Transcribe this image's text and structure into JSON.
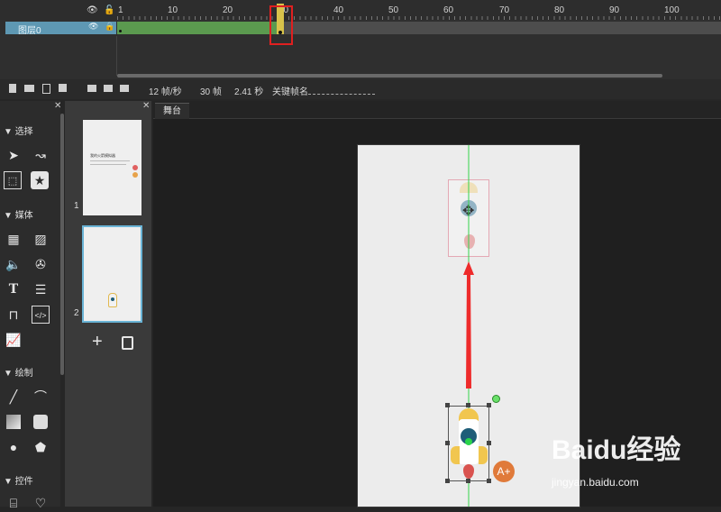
{
  "timeline": {
    "ruler_labels": [
      "1",
      "10",
      "20",
      "30",
      "40",
      "50",
      "60",
      "70",
      "80",
      "90",
      "100"
    ],
    "layer_name": "图层0",
    "fps": "12 帧/秒",
    "frames": "30 帧",
    "seconds": "2.41 秒",
    "keyframe_label": "关键帧名",
    "current_frame": 30
  },
  "tools": {
    "sections": [
      "选择",
      "媒体",
      "绘制",
      "控件"
    ]
  },
  "pages": {
    "numbers": [
      "1",
      "2"
    ],
    "thumb1_title": "我的火箭模拟器"
  },
  "stage": {
    "tab_label": "舞台"
  },
  "watermark": {
    "brand": "Baidu经验",
    "url": "jingyan.baidu.com"
  },
  "colors": {
    "accent": "#5e98b3",
    "frames_green": "#5b9a4f",
    "highlight_red": "#e02020",
    "motion_arrow": "#ee2b2b",
    "guide_green": "#35d44a"
  }
}
